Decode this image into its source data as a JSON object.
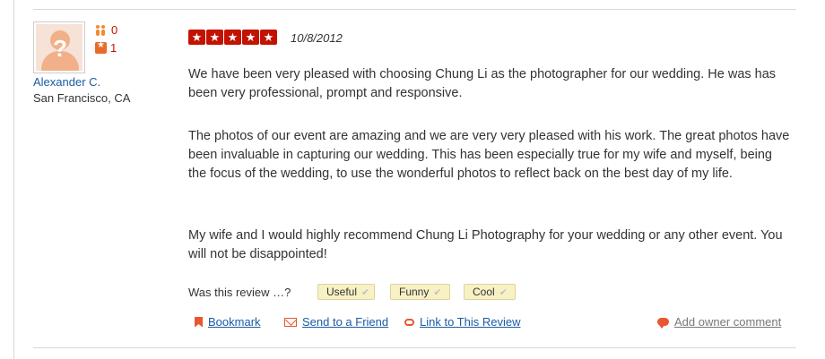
{
  "reviewer": {
    "name": "Alexander C.",
    "location": "San Francisco, CA",
    "friend_count": "0",
    "review_count": "1",
    "avatar_icon": "default-avatar-question-icon"
  },
  "review": {
    "rating": 5,
    "rating_max": 5,
    "date": "10/8/2012",
    "paragraphs": [
      "We have been very pleased with choosing Chung Li as the photographer for our wedding. He was has been very professional, prompt and responsive.",
      "The photos of our event are amazing and we are very very pleased with his work. The great photos have been invaluable in capturing our wedding. This has been especially true for my wife and myself, being the focus of the wedding, to use the wonderful photos to reflect back on the best day of my life.",
      "My wife and I would highly recommend Chung Li Photography for your wedding or any other event. You will not be disappointed!"
    ]
  },
  "votes": {
    "prompt": "Was this review …?",
    "useful": "Useful",
    "funny": "Funny",
    "cool": "Cool"
  },
  "actions": {
    "bookmark": "Bookmark",
    "send": "Send to a Friend",
    "link": "Link to This Review",
    "owner_comment": "Add owner comment"
  },
  "colors": {
    "star_red": "#c41200",
    "link_blue": "#1a5ba6",
    "icon_orange": "#e8572e",
    "vote_bg": "#f7f1c4"
  }
}
